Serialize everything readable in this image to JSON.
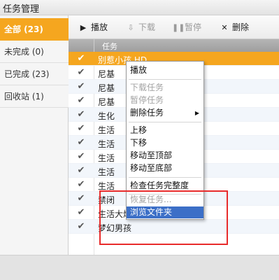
{
  "window": {
    "title": "任务管理"
  },
  "sidebar": {
    "items": [
      {
        "label": "全部 (23)"
      },
      {
        "label": "未完成 (0)"
      },
      {
        "label": "已完成 (23)"
      },
      {
        "label": "回收站 (1)"
      }
    ]
  },
  "toolbar": {
    "play": "播放",
    "download": "下载",
    "pause": "暂停",
    "delete": "删除"
  },
  "table": {
    "header": "任务",
    "rows": [
      "别惹小孩 HD",
      "尼基",
      "尼基",
      "尼基",
      "生化",
      "生活",
      "生活",
      "生活",
      "生活",
      "生活",
      "禁闭",
      "生活大爆炸第2季 01-03",
      "梦幻男孩"
    ]
  },
  "context_menu": {
    "play": "播放",
    "download_task": "下载任务",
    "pause_task": "暂停任务",
    "delete_task": "删除任务",
    "move_up": "上移",
    "move_down": "下移",
    "move_top": "移动至顶部",
    "move_bottom": "移动至底部",
    "check_integrity": "检查任务完整度",
    "restore_task": "恢复任务...",
    "browse_folder": "浏览文件夹"
  },
  "colors": {
    "accent": "#f5a61f",
    "highlight": "#3c6fc7",
    "annotation": "#e82b2b"
  }
}
